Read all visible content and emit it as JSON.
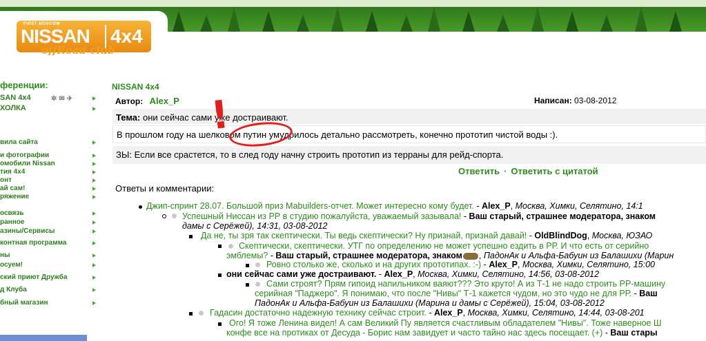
{
  "logo": {
    "small_text": "FIRST MOSCOW",
    "brand": "NISSAN",
    "model": "4x4",
    "subtitle": "offRoad club"
  },
  "sidebar": {
    "title": "ференции:",
    "sub_items": [
      {
        "label": "SAN 4x4"
      },
      {
        "label": "ХОЛКА"
      }
    ],
    "items": [
      {
        "label": "вила сайта"
      },
      {
        "label": "и фотографии"
      },
      {
        "label": "омобили Nissan"
      },
      {
        "label": "тия 4x4"
      },
      {
        "label": "онт"
      },
      {
        "label": "ай сам!"
      },
      {
        "label": "ряжение"
      },
      {
        "label": "освязь"
      },
      {
        "label": "ранное"
      },
      {
        "label": "азины/Сервисы"
      },
      {
        "label": "контная программа"
      },
      {
        "label": "ны"
      },
      {
        "label": "осуем!"
      },
      {
        "label": "ский приют Дружба"
      },
      {
        "label": "д Клуба"
      },
      {
        "label": "бный магазин"
      }
    ]
  },
  "post": {
    "section": "NISSAN 4x4",
    "author_label": "Автор:",
    "author": "Alex_P",
    "date_label": "Написан:",
    "date": "03-08-2012",
    "topic_label": "Тема:",
    "topic": "они сейчас сами уже достраивают.",
    "body": "В прошлом году на шелковом путин умудрилось детально рассмотреть, конечно прототип чистой воды :).",
    "ps": "ЗЫ: Если все срастется, то в след году начну строить прототип из терраны для рейд-спорта.",
    "reply": "Ответить",
    "reply_sep": "·",
    "reply_quote": "Ответить с цитатой"
  },
  "comments": {
    "title": "Ответы и комментарии:",
    "items": [
      {
        "text": "Джип-спринт 28.07. Большой приз Mabuilders-отчет. Может интересно кому будет.",
        "author": "Alex_P",
        "meta": "Москва, Химки, Селятино, 14:1"
      },
      {
        "text": "Успешный Ниссан из РР в студию пожалуйста, уважаемый зазывала!",
        "author": "Ваш старый, страшнее модератора, знаком",
        "meta": "дамы с Серёжей), 14:31, 03-08-2012"
      },
      {
        "text": "Да не, ты зря так скептически. Ты ведь скептически? Ну признай, признай давай!",
        "author": "OldBlindDog",
        "meta": "Москва, ЮЗАО"
      },
      {
        "text": "Скептически, скептически. УТГ по определению не может успешно ездить в РР. И что есть от серийно",
        "line2": "эмблемы?",
        "author": "Ваш старый, страшнее модератора, знаком",
        "meta": "ПадонАк и Альфа-Бабуин из Балашихи (Марин"
      },
      {
        "text": "Ровно столько же, сколько и на других прототипах. :-)",
        "author": "Alex_P",
        "meta": "Москва, Химки, Селятино, 15:00"
      },
      {
        "text": "они сейчас сами уже достраивают.",
        "author": "Alex_P",
        "meta": "Москва, Химки, Селятино, 14:56, 03-08-2012"
      },
      {
        "text": "Сами строят? Прям гипоид напильником ваяют??? Это круто! А из Т-1 не надо строить РР-машину",
        "line2": "серийная \"Паджеро\". Я понимаю, что после \"Нивы\" Т-1 кажется чудом, но это чудо не для РР.",
        "author2": "Ваш",
        "meta": "ПадонАк и Альфа-Бабуин из Балашихи (Марина и дамы с Серёжей), 15:04, 03-08-2012"
      },
      {
        "text": "Гадасин достаточно надежную технику сейчас строит.",
        "author": "Alex_P",
        "meta": "Москва, Химки, Селятино, 14:44, 03-08-201"
      },
      {
        "text": "Ого! Я тоже Ленина видел! А сам Великий Пу является счастливым обладателем \"Нивы\". Тоже наверное Ш",
        "line2": "конфе все на протиках от Десуда - Борис нам завидует и часто тайно нас здесь посещает. (+)",
        "author2": "Ваш стары"
      }
    ]
  },
  "annotation": {
    "bang": "!"
  },
  "colors": {
    "link_green": "#2e8b1e",
    "annotation_red": "#e02020",
    "logo_orange": "#f0a020"
  }
}
